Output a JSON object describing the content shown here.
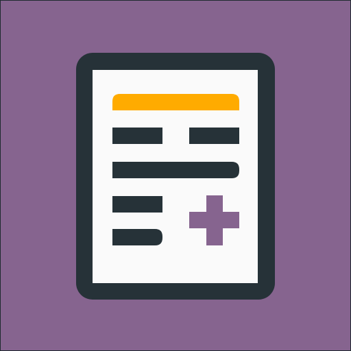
{
  "app_icon": {
    "icon": "document-add-icon",
    "colors": {
      "background": "#86648F",
      "outline": "#263238",
      "paper": "#FAFAFA",
      "highlight_line": "#FFAB00",
      "text_lines": "#263238",
      "plus": "#86648F"
    }
  }
}
